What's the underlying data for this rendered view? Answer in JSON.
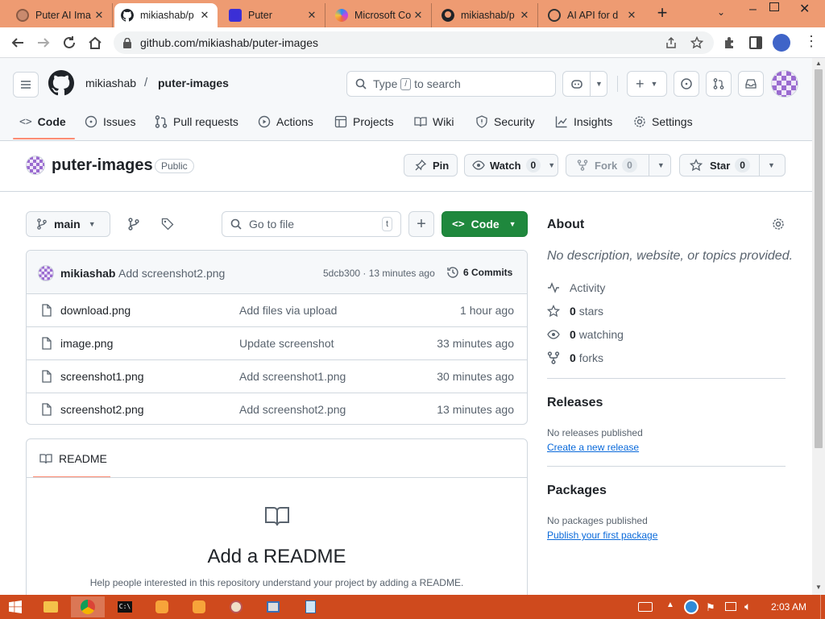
{
  "browser": {
    "tabs": [
      {
        "title": "Puter AI Ima",
        "icon": "puter-ai-favicon"
      },
      {
        "title": "mikiashab/p",
        "icon": "github-favicon",
        "active": true
      },
      {
        "title": "Puter",
        "icon": "puter-favicon"
      },
      {
        "title": "Microsoft Co",
        "icon": "copilot-favicon"
      },
      {
        "title": "mikiashab/p",
        "icon": "github-favicon"
      },
      {
        "title": "AI API for d",
        "icon": "openai-favicon"
      }
    ],
    "url": "github.com/mikiashab/puter-images"
  },
  "header": {
    "owner": "mikiashab",
    "separator": "/",
    "repo": "puter-images",
    "search": {
      "prefix": "Type",
      "key": "/",
      "suffix": "to search"
    }
  },
  "nav": {
    "items": [
      "Code",
      "Issues",
      "Pull requests",
      "Actions",
      "Projects",
      "Wiki",
      "Security",
      "Insights",
      "Settings"
    ],
    "active": "Code"
  },
  "repo": {
    "name": "puter-images",
    "visibility": "Public",
    "pin_label": "Pin",
    "watch_label": "Watch",
    "watch_count": "0",
    "fork_label": "Fork",
    "fork_count": "0",
    "star_label": "Star",
    "star_count": "0"
  },
  "toolbar": {
    "branch": "main",
    "goto_placeholder": "Go to file",
    "goto_key": "t",
    "code_label": "Code"
  },
  "latest_commit": {
    "author": "mikiashab",
    "message": "Add screenshot2.png",
    "hash_time": "5dcb300 · 13 minutes ago",
    "commits_label": "6 Commits"
  },
  "files": [
    {
      "name": "download.png",
      "message": "Add files via upload",
      "time": "1 hour ago"
    },
    {
      "name": "image.png",
      "message": "Update screenshot",
      "time": "33 minutes ago"
    },
    {
      "name": "screenshot1.png",
      "message": "Add screenshot1.png",
      "time": "30 minutes ago"
    },
    {
      "name": "screenshot2.png",
      "message": "Add screenshot2.png",
      "time": "13 minutes ago"
    }
  ],
  "readme": {
    "tab_label": "README",
    "title": "Add a README",
    "description": "Help people interested in this repository understand your project by adding a README."
  },
  "about": {
    "heading": "About",
    "description": "No description, website, or topics provided.",
    "activity": "Activity",
    "stars_count": "0",
    "stars_label": "stars",
    "watching_count": "0",
    "watching_label": "watching",
    "forks_count": "0",
    "forks_label": "forks"
  },
  "releases": {
    "heading": "Releases",
    "none": "No releases published",
    "link": "Create a new release"
  },
  "packages": {
    "heading": "Packages",
    "none": "No packages published",
    "link": "Publish your first package"
  },
  "taskbar": {
    "clock": "2:03 AM"
  },
  "colors": {
    "tabstrip": "#ee9b72",
    "taskbar": "#cf4a1d",
    "code_button": "#1f883d",
    "link": "#0969da",
    "active_underline": "#fd8c73"
  }
}
